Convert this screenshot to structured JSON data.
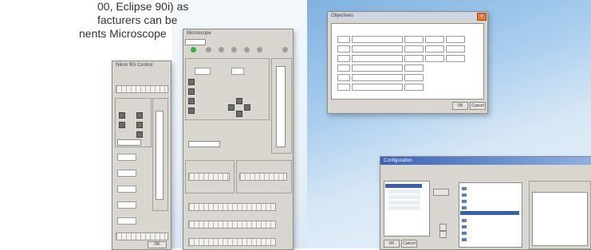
{
  "copy": {
    "line1": "00, Eclipse 90i) as",
    "line2": "facturers can be",
    "line3": "nents Microscope"
  },
  "windows": {
    "left": {
      "title": "Nikon 90i Control",
      "button": "OK"
    },
    "middle": {
      "title": "Microscope"
    },
    "table": {
      "title": "Objectives",
      "ok": "OK",
      "cancel": "Cancel"
    },
    "tree": {
      "title": "Configuration",
      "ok": "OK",
      "cancel": "Cancel"
    }
  },
  "colors": {
    "accent": "#2fb34a",
    "titlebar": "#3a64b8",
    "close": "#e07a3a",
    "selection": "#3a5fb0"
  }
}
